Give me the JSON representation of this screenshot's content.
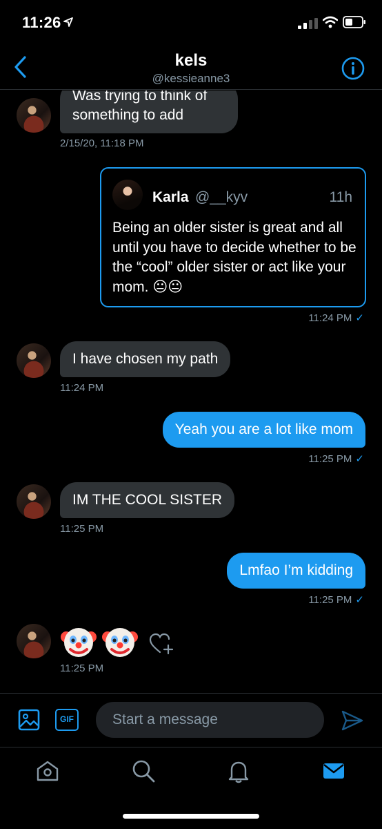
{
  "status_bar": {
    "time": "11:26"
  },
  "header": {
    "name": "kels",
    "handle": "@kessieanne3"
  },
  "messages": [
    {
      "id": "m1",
      "direction": "in",
      "text_line1": "Was trying to think of",
      "text_line2": "something to add",
      "timestamp": "2/15/20, 11:18 PM"
    },
    {
      "id": "m2",
      "direction": "out",
      "type": "tweet",
      "timestamp": "11:24 PM",
      "tweet": {
        "name": "Karla",
        "handle": "@__kyv",
        "time": "11h",
        "text": "Being an older sister is great and all until you have to decide whether to be the “cool” older sister or act like your mom. 😐😐"
      }
    },
    {
      "id": "m3",
      "direction": "in",
      "text": "I have chosen my path",
      "timestamp": "11:24 PM"
    },
    {
      "id": "m4",
      "direction": "out",
      "text": "Yeah you are a lot like mom",
      "timestamp": "11:25 PM"
    },
    {
      "id": "m5",
      "direction": "in",
      "text": "IM THE COOL SISTER",
      "timestamp": "11:25 PM"
    },
    {
      "id": "m6",
      "direction": "out",
      "text": "Lmfao I’m kidding",
      "timestamp": "11:25 PM"
    },
    {
      "id": "m7",
      "direction": "in",
      "type": "emoji",
      "text": "🤡🤡",
      "timestamp": "11:25 PM"
    }
  ],
  "composer": {
    "placeholder": "Start a message",
    "gif_label": "GIF"
  },
  "icons": {
    "back": "chevron-left-icon",
    "info": "info-icon",
    "media": "image-icon",
    "send": "send-icon",
    "nav": [
      "home-icon",
      "search-icon",
      "notifications-icon",
      "messages-icon"
    ]
  },
  "colors": {
    "accent": "#1d9bf0",
    "background": "#000000",
    "bubble_in": "#2f3336",
    "muted": "#8899a6"
  }
}
